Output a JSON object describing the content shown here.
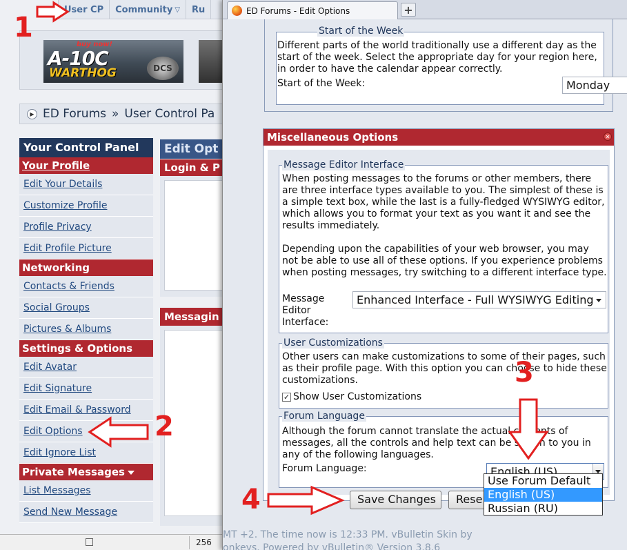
{
  "back_window": {
    "top_nav": {
      "user_cp": "User CP",
      "community": "Community",
      "ru": "Ru"
    },
    "banner": {
      "buy_now": "buy now!",
      "title": "A-10C",
      "subtitle": "WARTHOG",
      "dcs": "DCS"
    },
    "breadcrumb": {
      "site": "ED Forums",
      "separator": "»",
      "page": "User Control Pa"
    },
    "control_panel": {
      "title": "Your Control Panel",
      "your_profile": "Your Profile",
      "profile_items": [
        "Edit Your Details",
        "Customize Profile",
        "Profile Privacy",
        "Edit Profile Picture"
      ],
      "networking": "Networking",
      "networking_items": [
        "Contacts & Friends",
        "Social Groups",
        "Pictures & Albums"
      ],
      "settings": "Settings & Options",
      "settings_items": [
        "Edit Avatar",
        "Edit Signature",
        "Edit Email & Password",
        "Edit Options",
        "Edit Ignore List"
      ],
      "private_messages": "Private Messages",
      "pm_items": [
        "List Messages",
        "Send New Message"
      ]
    },
    "edit_options_head": "Edit Opt",
    "login_head": "Login & P",
    "messaging_head": "Messagin",
    "status_bar": {
      "zoom": "256"
    }
  },
  "browser": {
    "tab_title": "ED Forums - Edit Options",
    "new_tab": "+",
    "start_week": {
      "legend": "Start of the Week",
      "description": "Different parts of the world traditionally use a different day as the start of the week. Select the appropriate day for your region here, in order to have the calendar appear correctly.",
      "label": "Start of the Week:",
      "value": "Monday"
    },
    "misc": {
      "title": "Miscellaneous Options",
      "editor": {
        "legend": "Message Editor Interface",
        "description1": "When posting messages to the forums or other members, there are three interface types available to you. The simplest of these is a simple text box, while the last is a fully-fledged WYSIWYG editor, which allows you to format your text as you want it and see the results immediately.",
        "description2": "Depending upon the capabilities of your web browser, you may not be able to use all of these options. If you experience problems when posting messages, try switching to a different interface type.",
        "label": "Message Editor Interface:",
        "value": "Enhanced Interface - Full WYSIWYG Editing"
      },
      "customizations": {
        "legend": "User Customizations",
        "description": "Other users can make customizations to some of their pages, such as their profile page. With this option you can choose to hide these customizations.",
        "checkbox_label": "Show User Customizations",
        "checked": true
      },
      "language": {
        "legend": "Forum Language",
        "description": "Although the forum cannot translate the actual contents of messages, all the controls and help text can be shown to you in any of the following languages.",
        "label": "Forum Language:",
        "value": "English (US)",
        "options": [
          "Use Forum Default",
          "English (US)",
          "Russian (RU)"
        ],
        "selected_index": 1
      }
    },
    "buttons": {
      "save": "Save Changes",
      "reset": "Rese"
    },
    "footer": {
      "line1": "MT +2. The time now is 12:33 PM. vBulletin Skin by",
      "line2": "onkeys. Powered by vBulletin® Version 3.8.6"
    }
  },
  "annotations": {
    "step1": "1",
    "step2": "2",
    "step3": "3",
    "step4": "4",
    "color": "#e22020"
  }
}
